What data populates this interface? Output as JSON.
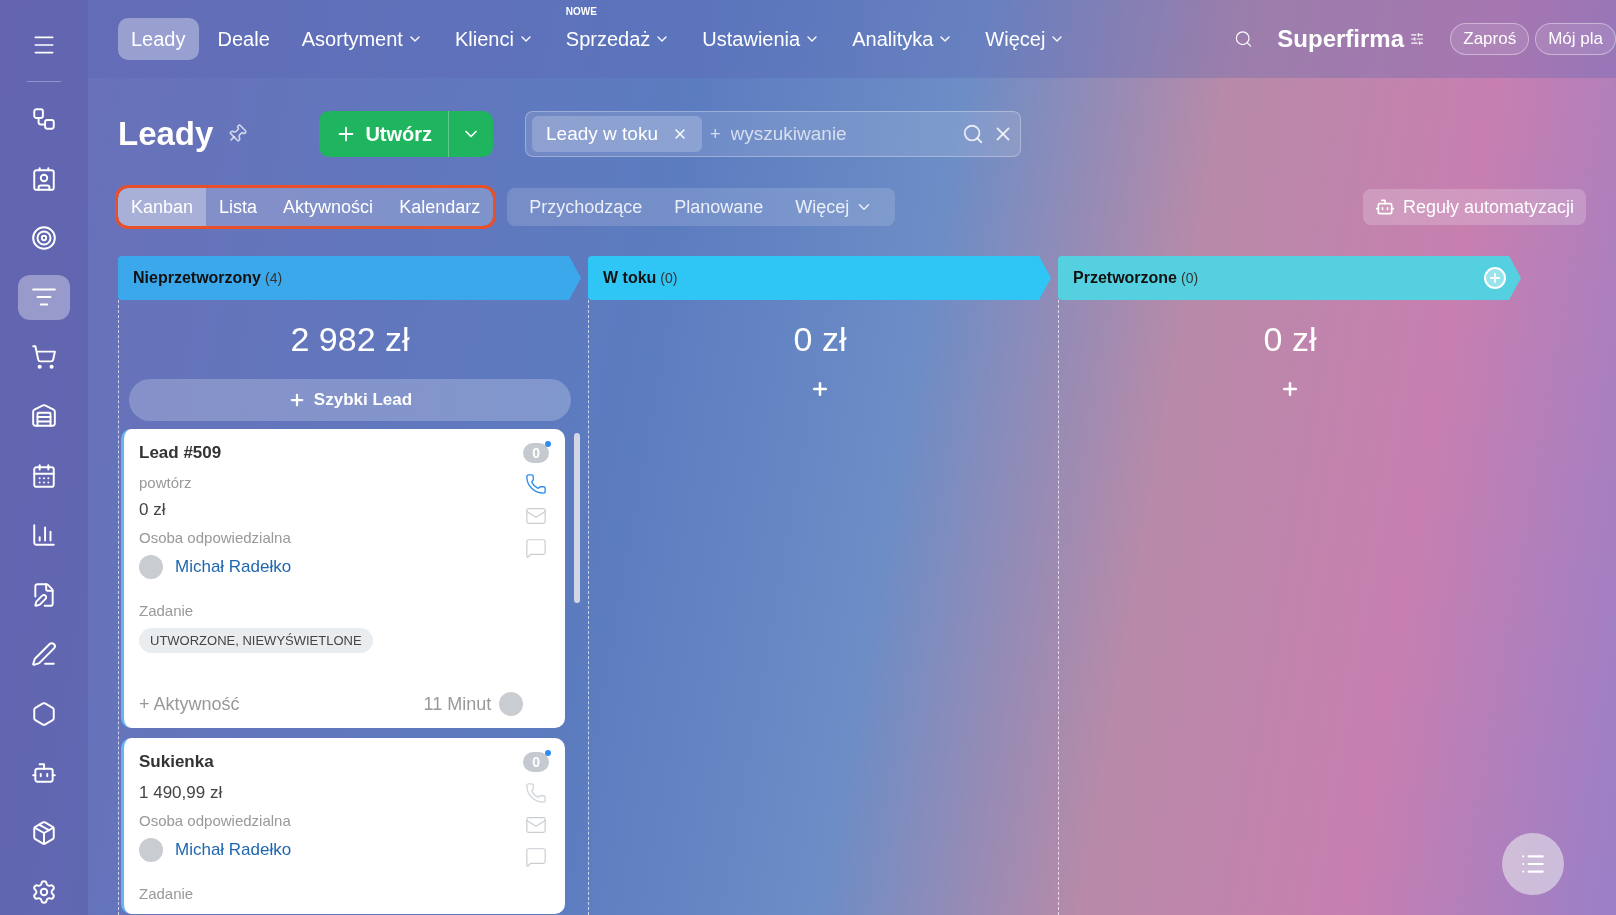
{
  "sidebar": {
    "items": [
      {
        "kind": "nodes",
        "selected": false
      },
      {
        "kind": "contacts",
        "selected": false
      },
      {
        "kind": "target",
        "selected": false
      },
      {
        "kind": "funnel",
        "selected": true
      },
      {
        "kind": "cart",
        "selected": false
      },
      {
        "kind": "warehouse",
        "selected": false
      },
      {
        "kind": "calendar",
        "selected": false
      },
      {
        "kind": "chart",
        "selected": false
      },
      {
        "kind": "document",
        "selected": false
      },
      {
        "kind": "pen",
        "selected": false
      },
      {
        "kind": "hexagon",
        "selected": false
      },
      {
        "kind": "robot",
        "selected": false
      },
      {
        "kind": "box",
        "selected": false
      },
      {
        "kind": "settings",
        "selected": false
      }
    ]
  },
  "nav": {
    "items": [
      {
        "label": "Leady",
        "selected": true,
        "dropdown": false
      },
      {
        "label": "Deale",
        "selected": false,
        "dropdown": false
      },
      {
        "label": "Asortyment",
        "selected": false,
        "dropdown": true
      },
      {
        "label": "Klienci",
        "selected": false,
        "dropdown": true
      },
      {
        "label": "Sprzedaż",
        "selected": false,
        "dropdown": true,
        "badge": "NOWE"
      },
      {
        "label": "Ustawienia",
        "selected": false,
        "dropdown": true
      },
      {
        "label": "Analityka",
        "selected": false,
        "dropdown": true
      },
      {
        "label": "Więcej",
        "selected": false,
        "dropdown": true
      }
    ],
    "brand": "Superfirma",
    "buttons": [
      "Zaproś",
      "Mój pla"
    ]
  },
  "page": {
    "title": "Leady",
    "create_button": "Utwórz",
    "filter": {
      "tag": "Leady w toku",
      "plus": "+",
      "placeholder": "wyszukiwanie"
    }
  },
  "view_tabs": {
    "highlighted": true,
    "items": [
      {
        "label": "Kanban",
        "selected": true
      },
      {
        "label": "Lista",
        "selected": false
      },
      {
        "label": "Aktywności",
        "selected": false
      },
      {
        "label": "Kalendarz",
        "selected": false
      }
    ]
  },
  "filters": [
    {
      "label": "Przychodzące",
      "dropdown": false
    },
    {
      "label": "Planowane",
      "dropdown": false
    },
    {
      "label": "Więcej",
      "dropdown": true
    }
  ],
  "automation_button": "Reguły automatyzacji",
  "columns": [
    {
      "title": "Nieprzetworzony",
      "count": "(4)",
      "color": "#3ba8ec",
      "total": "2 982 zł",
      "quick_add": "Szybki Lead",
      "add_icon": false,
      "cards": [
        {
          "title": "Lead #509",
          "subtitle": "powtórz",
          "amount": "0 zł",
          "responsible_label": "Osoba odpowiedzialna",
          "person": "Michał Radełko",
          "task_label": "Zadanie",
          "task_status": "UTWORZONE, NIEWYŚWIETLONE",
          "counter": "0",
          "phone_active": true,
          "activity": "+ Aktywność",
          "time": "11 Minut"
        },
        {
          "title": "Sukienka",
          "amount": "1 490,99 zł",
          "responsible_label": "Osoba odpowiedzialna",
          "person": "Michał Radełko",
          "task_label": "Zadanie",
          "counter": "0",
          "phone_active": false
        }
      ]
    },
    {
      "title": "W toku",
      "count": "(0)",
      "color": "#2fc6f6",
      "total": "0 zł",
      "add_icon": false
    },
    {
      "title": "Przetworzone",
      "count": "(0)",
      "color": "#55d0e0",
      "total": "0 zł",
      "add_icon": true
    }
  ]
}
